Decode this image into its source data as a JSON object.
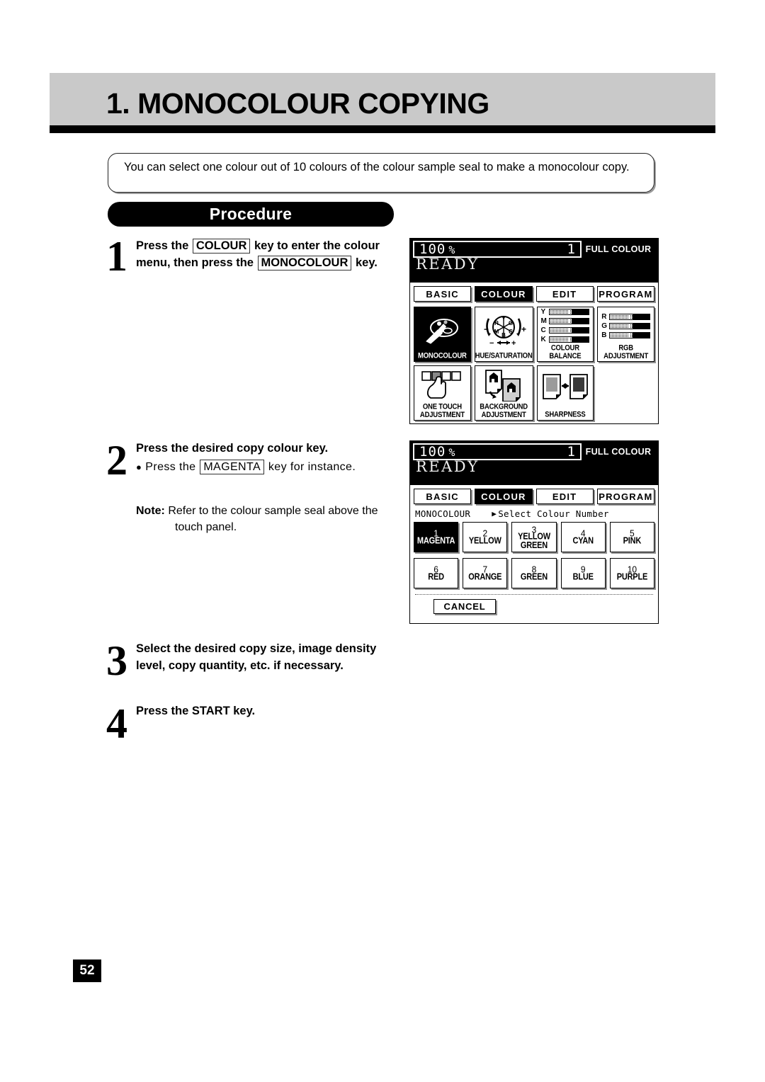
{
  "header": {
    "title": "1. MONOCOLOUR COPYING"
  },
  "intro": {
    "text": "You can select one colour out of 10 colours of the colour sample seal to make a monocolour copy."
  },
  "procedure": {
    "label": "Procedure"
  },
  "steps": [
    {
      "number": "1",
      "line1_a": "Press the",
      "key1": "COLOUR",
      "line1_b": "key to enter the colour",
      "line2_a": "menu, then press the",
      "key2": "MONOCOLOUR",
      "line2_b": "key."
    },
    {
      "number": "2",
      "heading": "Press the desired copy colour key.",
      "bullet_a": "Press the",
      "key": "MAGENTA",
      "bullet_b": "key for instance.",
      "note_label": "Note:",
      "note_line1": "Refer to the colour sample seal above the",
      "note_line2": "touch panel."
    },
    {
      "number": "3",
      "line1": "Select the desired copy size, image density",
      "line2": "level, copy quantity, etc. if necessary."
    },
    {
      "number": "4",
      "line1": "Press the START key."
    }
  ],
  "lcd_common": {
    "zoom": "100",
    "percent": "%",
    "copies": "1",
    "mode": "FULL COLOUR",
    "status": "READY",
    "tabs": [
      {
        "label": "BASIC",
        "selected": false
      },
      {
        "label": "COLOUR",
        "selected": true
      },
      {
        "label": "EDIT",
        "selected": false
      },
      {
        "label": "PROGRAM",
        "selected": false
      }
    ]
  },
  "lcd_panel_1": {
    "features": [
      {
        "label": "MONOCOLOUR",
        "icon": "palette-brush-icon",
        "selected": true
      },
      {
        "label": "HUE/SATURATION",
        "icon": "colour-wheel-icon",
        "selected": false
      },
      {
        "label": "COLOUR BALANCE",
        "icon": "ymck-bars-icon",
        "selected": false,
        "channels": [
          "Y",
          "M",
          "C",
          "K"
        ]
      },
      {
        "label": "RGB ADJUSTMENT",
        "icon": "rgb-bars-icon",
        "selected": false,
        "channels": [
          "R",
          "G",
          "B"
        ]
      },
      {
        "label": "ONE TOUCH ADJUSTMENT",
        "icon": "finger-touch-icon",
        "selected": false
      },
      {
        "label": "BACKGROUND ADJUSTMENT",
        "icon": "document-background-icon",
        "selected": false
      },
      {
        "label": "SHARPNESS",
        "icon": "sharpness-pages-icon",
        "selected": false
      }
    ],
    "wheel_segments": [
      "Y",
      "G",
      "C",
      "B",
      "M",
      "R"
    ],
    "wheel_minus": "−",
    "wheel_plus": "+"
  },
  "lcd_panel_2": {
    "breadcrumb_mode": "MONOCOLOUR",
    "breadcrumb_prompt": "Select Colour Number",
    "colours": [
      {
        "number": "1",
        "name": "MAGENTA",
        "selected": true
      },
      {
        "number": "2",
        "name": "YELLOW",
        "selected": false
      },
      {
        "number": "3",
        "name": "YELLOW GREEN",
        "selected": false
      },
      {
        "number": "4",
        "name": "CYAN",
        "selected": false
      },
      {
        "number": "5",
        "name": "PINK",
        "selected": false
      },
      {
        "number": "6",
        "name": "RED",
        "selected": false
      },
      {
        "number": "7",
        "name": "ORANGE",
        "selected": false
      },
      {
        "number": "8",
        "name": "GREEN",
        "selected": false
      },
      {
        "number": "9",
        "name": "BLUE",
        "selected": false
      },
      {
        "number": "10",
        "name": "PURPLE",
        "selected": false
      }
    ],
    "cancel_label": "CANCEL"
  },
  "footer": {
    "page_number": "52"
  }
}
